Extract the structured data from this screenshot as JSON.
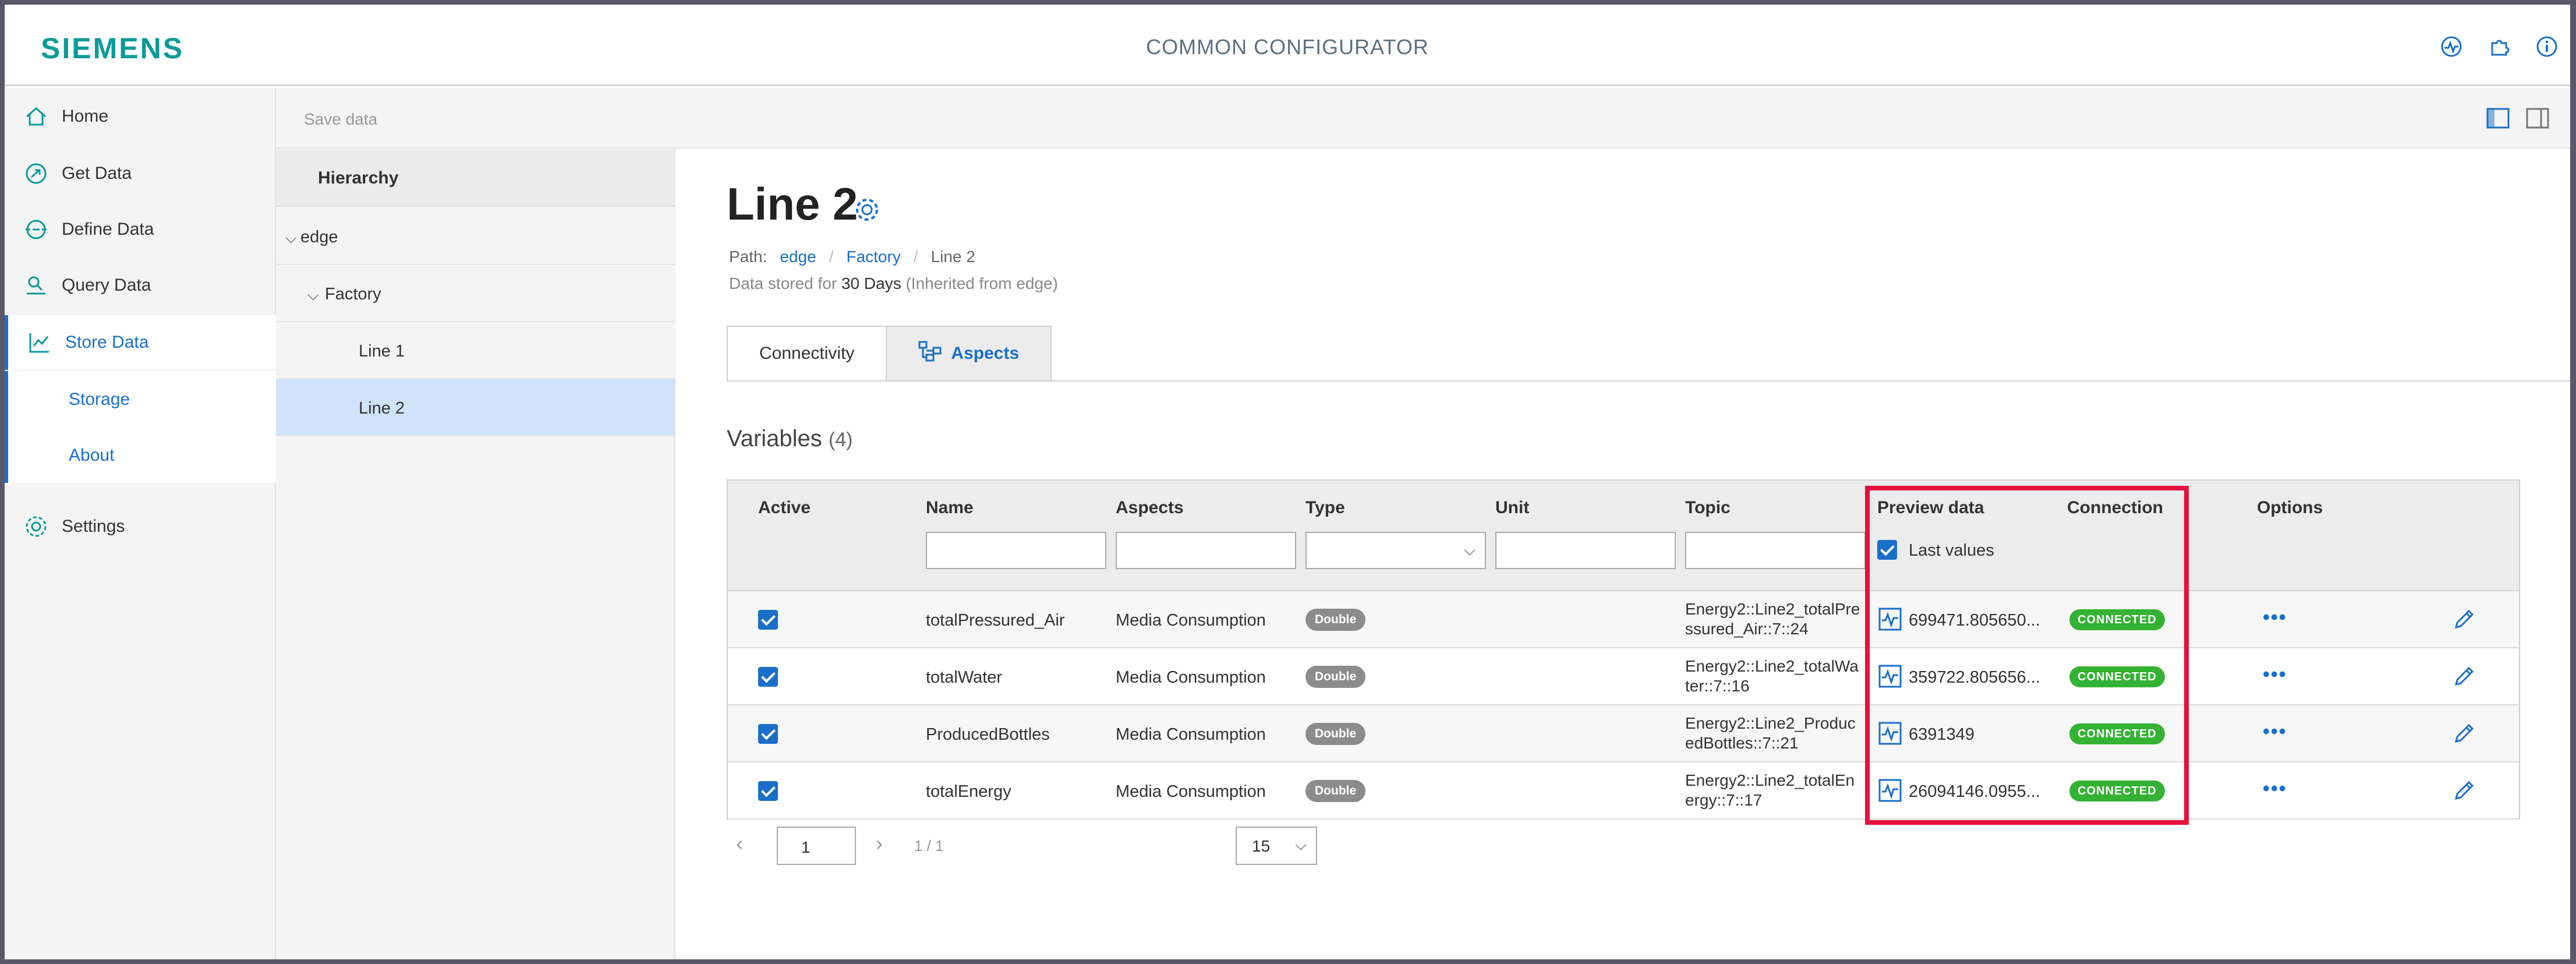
{
  "header": {
    "brand": "SIEMENS",
    "app_title": "COMMON CONFIGURATOR"
  },
  "icons": {
    "top": [
      "activity-icon",
      "puzzle-icon",
      "info-icon"
    ]
  },
  "colors": {
    "brand": "#0a9a9a",
    "accent": "#1a6fc9",
    "connected": "#34b233",
    "highlight": "#e5103d"
  },
  "sidebar": {
    "items": [
      {
        "label": "Home",
        "icon": "home-icon"
      },
      {
        "label": "Get Data",
        "icon": "get-data-icon"
      },
      {
        "label": "Define Data",
        "icon": "define-data-icon"
      },
      {
        "label": "Query Data",
        "icon": "query-data-icon"
      },
      {
        "label": "Store Data",
        "icon": "store-data-icon"
      },
      {
        "label": "Settings",
        "icon": "settings-icon"
      }
    ],
    "sub_items": [
      {
        "label": "Storage"
      },
      {
        "label": "About"
      }
    ]
  },
  "toolbar": {
    "save_label": "Save data"
  },
  "hierarchy": {
    "title": "Hierarchy",
    "nodes": [
      {
        "label": "edge",
        "expanded": true
      },
      {
        "label": "Factory",
        "expanded": true
      },
      {
        "label": "Line 1"
      },
      {
        "label": "Line 2",
        "selected": true
      }
    ]
  },
  "main": {
    "title": "Line 2",
    "path_label": "Path:",
    "path": [
      "edge",
      "Factory",
      "Line 2"
    ],
    "stored_prefix": "Data stored for",
    "stored_days": "30 Days",
    "stored_suffix": "(Inherited from edge)",
    "tabs": [
      {
        "label": "Connectivity"
      },
      {
        "label": "Aspects"
      }
    ],
    "variables_label": "Variables",
    "variables_count": "(4)"
  },
  "table": {
    "columns": [
      "Active",
      "Name",
      "Aspects",
      "Type",
      "Unit",
      "Topic",
      "Preview data",
      "Connection",
      "Options"
    ],
    "last_values_label": "Last values",
    "rows": [
      {
        "name": "totalPressured_Air",
        "aspect": "Media Consumption",
        "type": "Double",
        "topic1": "Energy2::Line2_totalPre",
        "topic2": "ssured_Air::7::24",
        "preview": "699471.805650...",
        "connection": "CONNECTED"
      },
      {
        "name": "totalWater",
        "aspect": "Media Consumption",
        "type": "Double",
        "topic1": "Energy2::Line2_totalWa",
        "topic2": "ter::7::16",
        "preview": "359722.805656...",
        "connection": "CONNECTED"
      },
      {
        "name": "ProducedBottles",
        "aspect": "Media Consumption",
        "type": "Double",
        "topic1": "Energy2::Line2_Produc",
        "topic2": "edBottles::7::21",
        "preview": "6391349",
        "connection": "CONNECTED"
      },
      {
        "name": "totalEnergy",
        "aspect": "Media Consumption",
        "type": "Double",
        "topic1": "Energy2::Line2_totalEn",
        "topic2": "ergy::7::17",
        "preview": "26094146.0955...",
        "connection": "CONNECTED"
      }
    ],
    "options_glyph": "•••"
  },
  "pager": {
    "page": "1",
    "count": "1 / 1",
    "page_size": "15"
  }
}
